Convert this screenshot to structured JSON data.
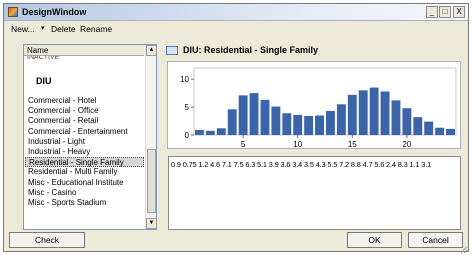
{
  "window": {
    "title": "DesignWindow",
    "controls": {
      "minimize": "_",
      "maximize": "□",
      "close": "X"
    }
  },
  "menu": {
    "new": "New...",
    "new_arrow": "▾",
    "delete": "Delete",
    "rename": "Rename"
  },
  "list": {
    "header": "Name",
    "cutoff_item": "INACTIVE",
    "group": "DIU",
    "items": [
      "Commercial - Hotel",
      "Commercial - Office",
      "Commercial - Retail",
      "Commercial - Entertainment",
      "Industrial - Light",
      "Industrial - Heavy",
      "Residential - Single Family",
      "Residential - Multi Family",
      "Misc - Educational Institute",
      "Misc - Casino",
      "Misc - Sports Stadium"
    ],
    "selected_index": 6
  },
  "detail": {
    "title": "DIU: Residential - Single Family",
    "values_text": "0.9 0.75 1.2 4.6 7.1 7.5 6.3 5.1 3.9 3.6 3.4 3.5 4.3 5.5 7.2 8.8 4.7 5.6 2.4 8.3 1.1 3.1"
  },
  "chart_data": {
    "type": "bar",
    "title": "",
    "xlabel": "",
    "ylabel": "",
    "x": [
      1,
      2,
      3,
      4,
      5,
      6,
      7,
      8,
      9,
      10,
      11,
      12,
      13,
      14,
      15,
      16,
      17,
      18,
      19,
      20,
      21,
      22,
      23,
      24
    ],
    "values": [
      0.9,
      0.75,
      1.2,
      4.6,
      7.1,
      7.5,
      6.3,
      5.1,
      3.9,
      3.6,
      3.4,
      3.5,
      4.3,
      5.5,
      7.2,
      8.0,
      8.5,
      7.8,
      6.2,
      4.8,
      3.2,
      2.4,
      1.3,
      1.1
    ],
    "ylim": [
      0,
      12
    ],
    "yticks": [
      0,
      5,
      10
    ],
    "xticks": [
      5,
      10,
      15,
      20
    ],
    "grid": false,
    "bar_color": "#3c64a8"
  },
  "buttons": {
    "check": "Check",
    "ok": "OK",
    "cancel": "Cancel"
  }
}
